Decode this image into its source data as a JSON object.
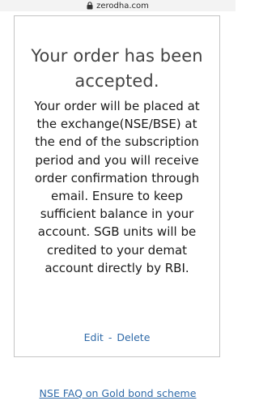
{
  "browser": {
    "domain": "zerodha.com"
  },
  "card": {
    "title": "Your order has been accepted.",
    "message": "Your order will be placed at the exchange(NSE/BSE) at the end of the subscription period and you will receive order confirmation through email. Ensure to keep sufficient balance in your account. SGB units will be credited to your demat account directly by RBI.",
    "edit_label": "Edit",
    "separator": "-",
    "delete_label": "Delete"
  },
  "footer": {
    "faq_link": "NSE FAQ on Gold bond scheme"
  }
}
